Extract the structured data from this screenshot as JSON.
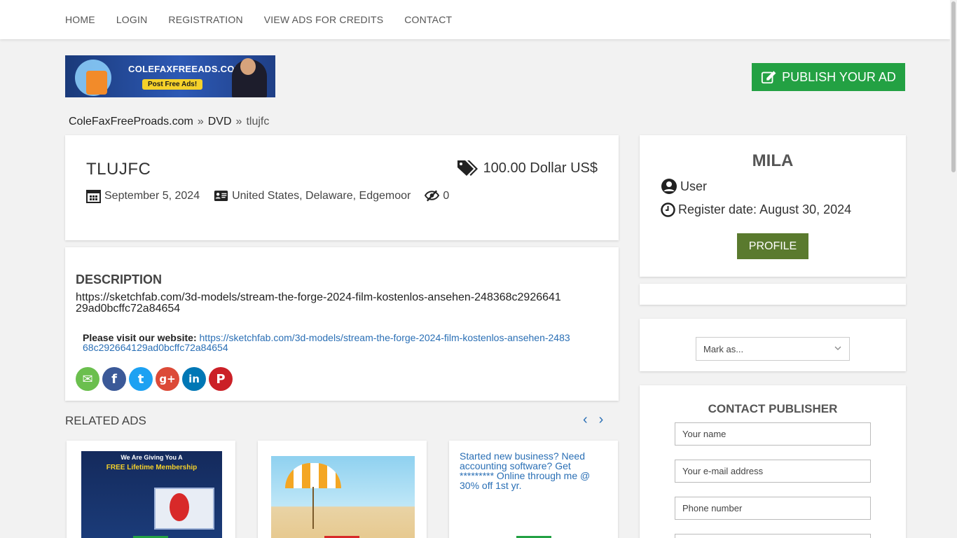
{
  "nav": {
    "items": [
      "HOME",
      "LOGIN",
      "REGISTRATION",
      "VIEW ADS FOR CREDITS",
      "CONTACT"
    ]
  },
  "banner": {
    "site": "COLEFAXFREEADS.COM",
    "cta": "Post Free Ads!"
  },
  "publish": {
    "label": "PUBLISH YOUR AD"
  },
  "breadcrumb": {
    "items": [
      "ColeFaxFreeProads.com",
      "DVD",
      "tlujfc"
    ],
    "separator": "»"
  },
  "ad": {
    "title": "TLUJFC",
    "price": "100.00 Dollar US$",
    "date": "September 5, 2024",
    "location": "United States, Delaware, Edgemoor",
    "views": "0"
  },
  "description": {
    "heading": "DESCRIPTION",
    "text": "https://sketchfab.com/3d-models/stream-the-forge-2024-film-kostenlos-ansehen-248368c292664129ad0bcffc72a84654",
    "visit_label": "Please visit our website:",
    "visit_link": "https://sketchfab.com/3d-models/stream-the-forge-2024-film-kostenlos-ansehen-248368c292664129ad0bcffc72a84654"
  },
  "social": [
    {
      "name": "email",
      "glyph": "✉",
      "color": "#6bbf4e"
    },
    {
      "name": "facebook",
      "glyph": "f",
      "color": "#3b5998"
    },
    {
      "name": "twitter",
      "glyph": "t",
      "color": "#1da1f2"
    },
    {
      "name": "google-plus",
      "glyph": "g+",
      "color": "#dc4a38"
    },
    {
      "name": "linkedin",
      "glyph": "in",
      "color": "#0077b5"
    },
    {
      "name": "pinterest",
      "glyph": "P",
      "color": "#cb2027"
    }
  ],
  "related": {
    "title": "RELATED ADS",
    "items": [
      {
        "img_title": "We Are Giving You A",
        "img_subtitle": "FREE Lifetime Membership"
      },
      {
        "img_title": ""
      },
      {
        "alt": "Started new business? Need accounting software? Get ********* Online through me @ 30% off 1st yr."
      }
    ]
  },
  "user": {
    "name": "MILA",
    "role": "User",
    "register": "Register date: August 30, 2024",
    "profile_label": "PROFILE"
  },
  "mark": {
    "placeholder": "Mark as..."
  },
  "contact": {
    "title": "CONTACT PUBLISHER",
    "fields": [
      "Your name",
      "Your e-mail address",
      "Phone number",
      ""
    ]
  },
  "colors": {
    "green": "#23a143",
    "olive": "#5a7a2e",
    "link": "#2a6fb5"
  }
}
